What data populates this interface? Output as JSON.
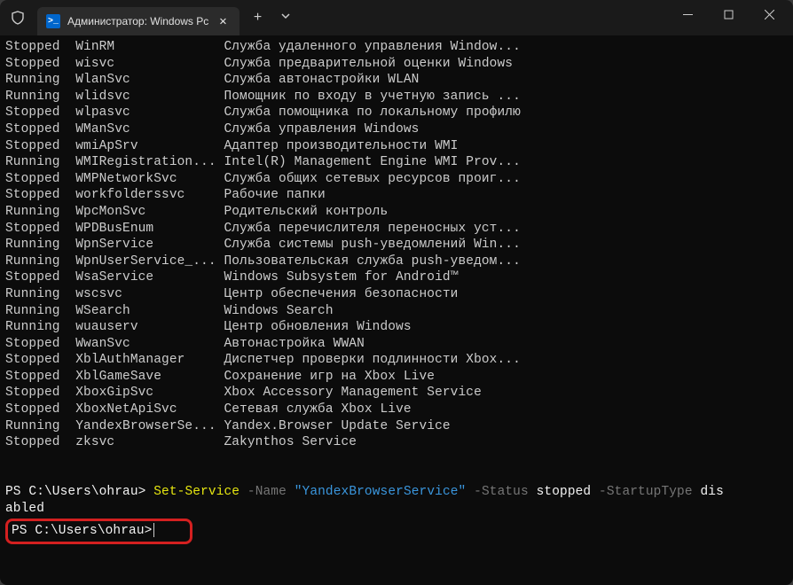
{
  "titlebar": {
    "tab_title": "Администратор: Windows Pc",
    "ps_glyph": ">_"
  },
  "services": [
    {
      "status": "Stopped",
      "name": "WinRM",
      "desc": "Служба удаленного управления Window..."
    },
    {
      "status": "Stopped",
      "name": "wisvc",
      "desc": "Служба предварительной оценки Windows"
    },
    {
      "status": "Running",
      "name": "WlanSvc",
      "desc": "Служба автонастройки WLAN"
    },
    {
      "status": "Running",
      "name": "wlidsvc",
      "desc": "Помощник по входу в учетную запись ..."
    },
    {
      "status": "Stopped",
      "name": "wlpasvc",
      "desc": "Служба помощника по локальному профилю"
    },
    {
      "status": "Stopped",
      "name": "WManSvc",
      "desc": "Служба управления Windows"
    },
    {
      "status": "Stopped",
      "name": "wmiApSrv",
      "desc": "Адаптер производительности WMI"
    },
    {
      "status": "Running",
      "name": "WMIRegistration...",
      "desc": "Intel(R) Management Engine WMI Prov..."
    },
    {
      "status": "Stopped",
      "name": "WMPNetworkSvc",
      "desc": "Служба общих сетевых ресурсов проиг..."
    },
    {
      "status": "Stopped",
      "name": "workfolderssvc",
      "desc": "Рабочие папки"
    },
    {
      "status": "Running",
      "name": "WpcMonSvc",
      "desc": "Родительский контроль"
    },
    {
      "status": "Stopped",
      "name": "WPDBusEnum",
      "desc": "Служба перечислителя переносных уст..."
    },
    {
      "status": "Running",
      "name": "WpnService",
      "desc": "Служба системы push-уведомлений Win..."
    },
    {
      "status": "Running",
      "name": "WpnUserService_...",
      "desc": "Пользовательская служба push-уведом..."
    },
    {
      "status": "Stopped",
      "name": "WsaService",
      "desc": "Windows Subsystem for Android™"
    },
    {
      "status": "Running",
      "name": "wscsvc",
      "desc": "Центр обеспечения безопасности"
    },
    {
      "status": "Running",
      "name": "WSearch",
      "desc": "Windows Search"
    },
    {
      "status": "Running",
      "name": "wuauserv",
      "desc": "Центр обновления Windows"
    },
    {
      "status": "Stopped",
      "name": "WwanSvc",
      "desc": "Автонастройка WWAN"
    },
    {
      "status": "Stopped",
      "name": "XblAuthManager",
      "desc": "Диспетчер проверки подлинности Xbox..."
    },
    {
      "status": "Stopped",
      "name": "XblGameSave",
      "desc": "Сохранение игр на Xbox Live"
    },
    {
      "status": "Stopped",
      "name": "XboxGipSvc",
      "desc": "Xbox Accessory Management Service"
    },
    {
      "status": "Stopped",
      "name": "XboxNetApiSvc",
      "desc": "Сетевая служба Xbox Live"
    },
    {
      "status": "Running",
      "name": "YandexBrowserSe...",
      "desc": "Yandex.Browser Update Service"
    },
    {
      "status": "Stopped",
      "name": "zksvc",
      "desc": "Zakynthos Service"
    }
  ],
  "cmd": {
    "prompt": "PS C:\\Users\\ohrau>",
    "cmdlet": "Set-Service",
    "p1": "-Name",
    "v1": "\"YandexBrowserService\"",
    "p2": "-Status",
    "v2": "stopped",
    "p3": "-StartupType",
    "v3_part1": "dis",
    "v3_part2": "abled"
  },
  "prompt2": "PS C:\\Users\\ohrau>"
}
